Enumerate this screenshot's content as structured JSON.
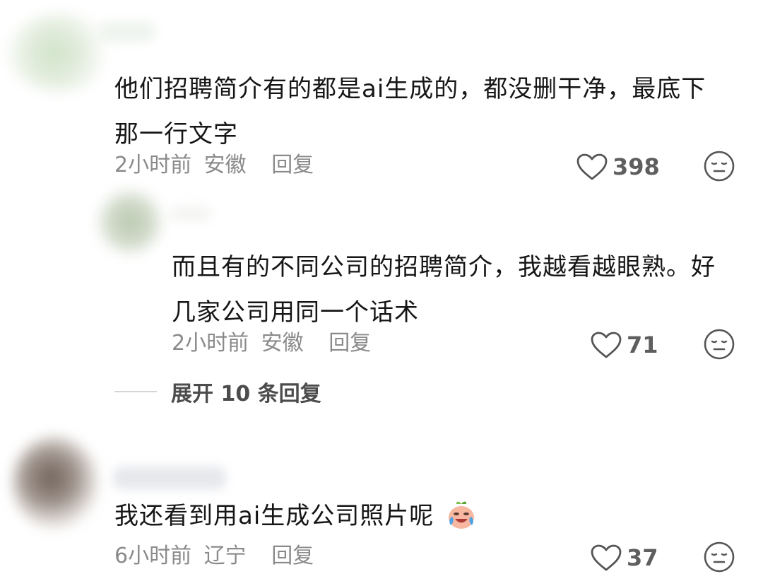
{
  "comments": [
    {
      "text_line1": "他们招聘简介有的都是ai生成的，都没删干净，最底下",
      "text_line2": "那一行文字",
      "time": "2小时前",
      "location": "安徽",
      "reply_label": "回复",
      "likes": "398"
    },
    {
      "text_line1": "而且有的不同公司的招聘简介，我越看越眼熟。好",
      "text_line2": "几家公司用同一个话术",
      "time": "2小时前",
      "location": "安徽",
      "reply_label": "回复",
      "likes": "71"
    },
    {
      "text_line1": "我还看到用ai生成公司照片呢",
      "time": "6小时前",
      "location": "辽宁",
      "reply_label": "回复",
      "likes": "37"
    }
  ],
  "expand_replies": {
    "label": "展开 10 条回复"
  },
  "icons": {
    "like": "heart-outline-icon",
    "dislike": "neutral-face-icon",
    "emoji": "crying-laughing-emoji-icon"
  },
  "colors": {
    "text": "#161616",
    "meta": "#8a8a8a",
    "icon": "#555555"
  }
}
